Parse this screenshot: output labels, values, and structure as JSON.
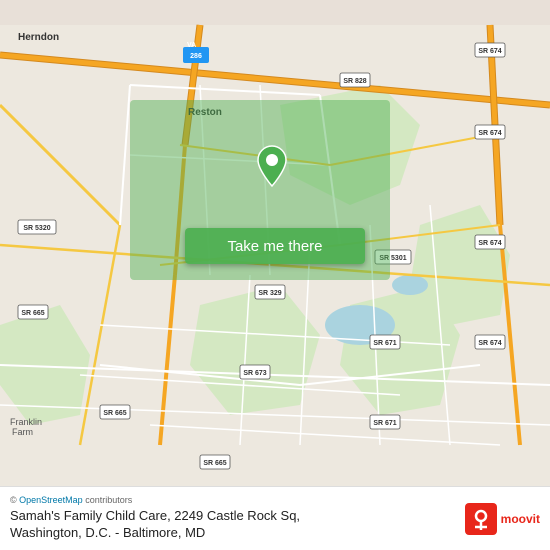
{
  "map": {
    "alt": "Map of Reston, Virginia area",
    "center_lat": 38.93,
    "center_lng": -77.35
  },
  "button": {
    "label": "Take me there"
  },
  "attribution": {
    "prefix": "© ",
    "link_text": "OpenStreetMap",
    "suffix": " contributors"
  },
  "location": {
    "name": "Samah's Family Child Care, 2249 Castle Rock Sq,",
    "city": "Washington, D.C. - Baltimore, MD"
  },
  "branding": {
    "name": "moovit"
  },
  "roads": {
    "va286": "VA 286",
    "sr674_1": "SR 674",
    "sr674_2": "SR 674",
    "sr674_3": "SR 674",
    "sr828": "SR 828",
    "sr5320": "SR 5320",
    "sr665_1": "SR 665",
    "sr665_2": "SR 665",
    "sr665_3": "SR 665",
    "sr329": "SR 329",
    "sr5301": "SR 5301",
    "sr673": "SR 673",
    "sr671_1": "SR 671",
    "sr671_2": "SR 671",
    "reston_label": "Reston",
    "herndon_label": "Herndon",
    "franklin_farm": "Franklin\nFarm"
  },
  "pin": {
    "color": "#4CAF50",
    "inner_color": "#ffffff"
  }
}
